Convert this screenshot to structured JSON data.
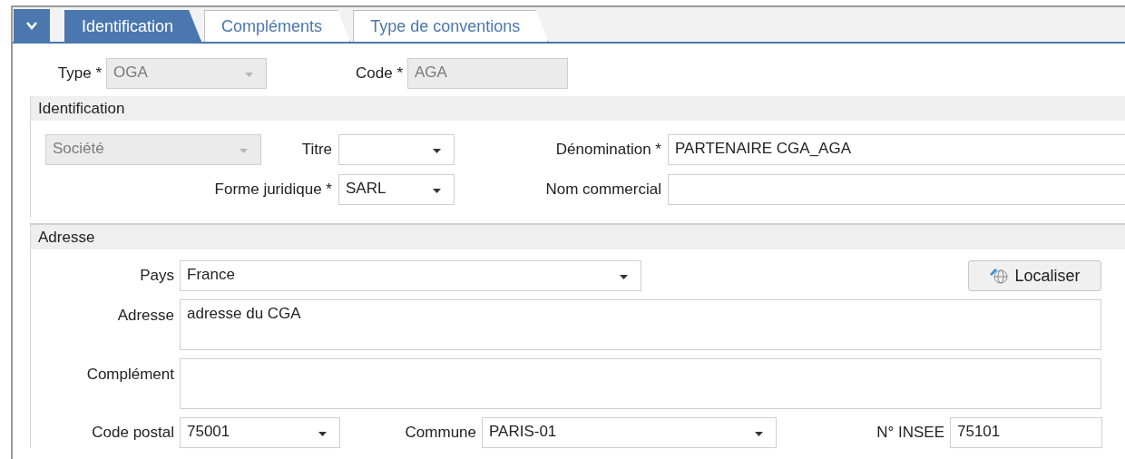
{
  "tabs": [
    {
      "label": "Identification",
      "selected": true
    },
    {
      "label": "Compléments",
      "selected": false
    },
    {
      "label": "Type de conventions",
      "selected": false
    }
  ],
  "header_fields": [
    {
      "label": "Type *",
      "value": "OGA",
      "kind": "dropdown",
      "disabled": true
    },
    {
      "label": "Code *",
      "value": "AGA",
      "kind": "text",
      "disabled": true
    }
  ],
  "identification": {
    "title": "Identification",
    "person_type": {
      "value": "Société",
      "kind": "dropdown",
      "disabled": true
    },
    "titre": {
      "label": "Titre",
      "kind": "dropdown",
      "disabled": false
    },
    "forme_juridique": {
      "label": "Forme juridique *",
      "value": "SARL",
      "kind": "dropdown",
      "disabled": false
    },
    "denomination": {
      "label": "Dénomination *",
      "value": "PARTENAIRE CGA_AGA",
      "kind": "text",
      "disabled": false
    },
    "nom_commercial": {
      "label": "Nom commercial",
      "kind": "text",
      "disabled": false
    }
  },
  "adresse": {
    "title": "Adresse",
    "pays": {
      "label": "Pays",
      "value": "France",
      "kind": "dropdown",
      "disabled": false
    },
    "locate_button": {
      "label": "Localiser"
    },
    "adresse": {
      "label": "Adresse",
      "value": "adresse du CGA",
      "kind": "multiline",
      "disabled": false
    },
    "complement": {
      "label": "Complément",
      "kind": "multiline",
      "disabled": false
    },
    "code_postal": {
      "label": "Code postal",
      "value": "75001",
      "kind": "dropdown",
      "disabled": false
    },
    "commune": {
      "label": "Commune",
      "value": "PARIS-01",
      "kind": "dropdown",
      "disabled": false
    },
    "insee": {
      "label": "N° INSEE",
      "value": "75101",
      "kind": "text",
      "disabled": false
    }
  }
}
